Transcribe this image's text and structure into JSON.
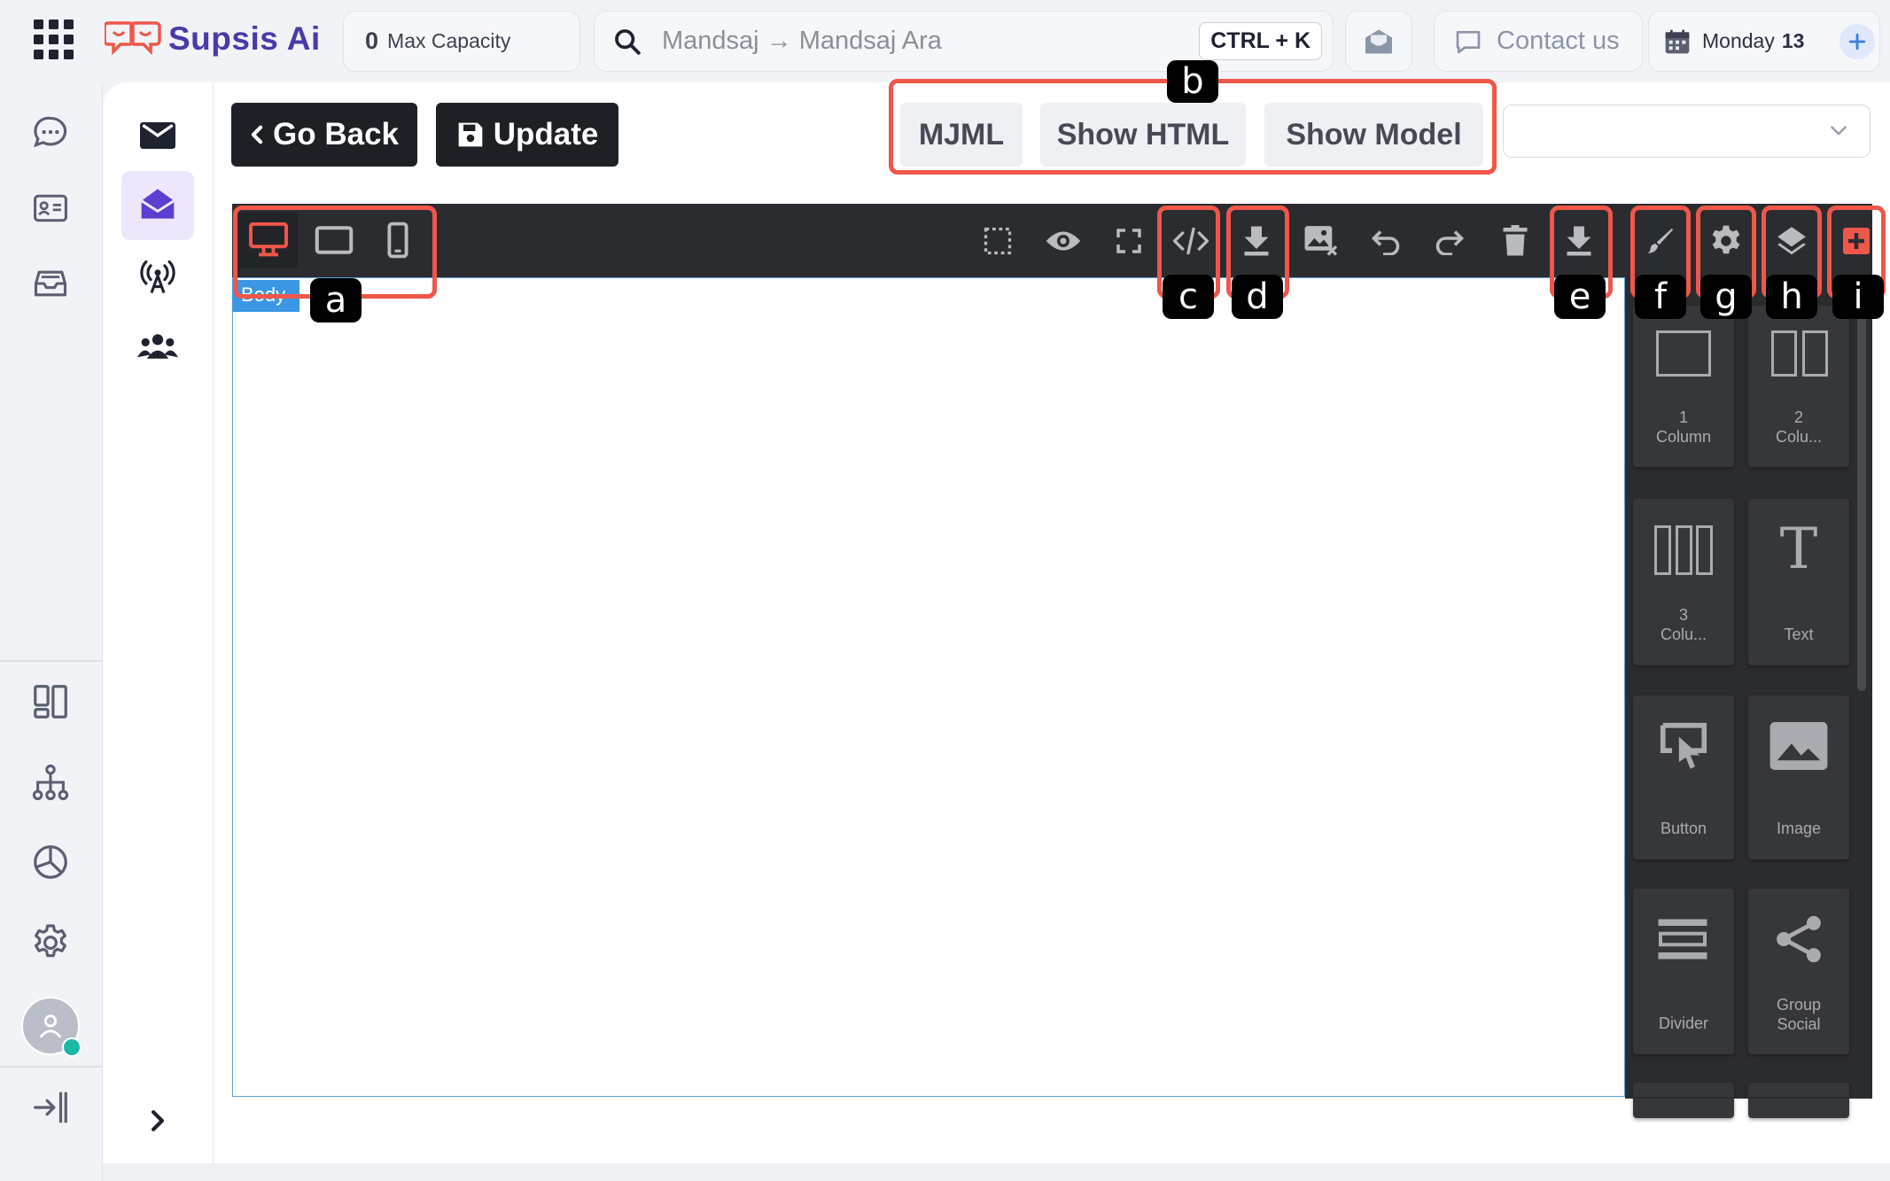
{
  "app": {
    "name": "Supsis Ai",
    "brand_color": "#4a3aa8",
    "logo_accent": "#f0564a"
  },
  "topbar": {
    "capacity_value": "0",
    "capacity_label": "Max Capacity",
    "search_placeholder": "Mandsaj → Mandsaj Ara",
    "search_shortcut": "CTRL + K",
    "contact_label": "Contact us",
    "date_label": "Monday",
    "date_day": "13"
  },
  "main": {
    "back_label": "Go Back",
    "update_label": "Update",
    "view_tabs": [
      {
        "label": "MJML"
      },
      {
        "label": "Show HTML"
      },
      {
        "label": "Show Model"
      }
    ],
    "select_value": ""
  },
  "editor": {
    "body_tag": "Body",
    "devices": [
      "desktop-icon",
      "tablet-icon",
      "mobile-icon"
    ],
    "active_device": "desktop",
    "toolbar_actions": [
      "select-outline-icon",
      "eye-icon",
      "fullscreen-icon",
      "code-icon",
      "download-icon",
      "image-remove-icon",
      "undo-icon",
      "redo-icon",
      "trash-icon"
    ],
    "panel_actions": [
      "download-icon",
      "brush-icon",
      "gear-icon",
      "layers-icon",
      "plus-icon"
    ],
    "active_color": "#f0564a",
    "blocks": [
      {
        "label_line1": "1",
        "label_line2": "Column",
        "icon": "one-column-icon"
      },
      {
        "label_line1": "2",
        "label_line2": "Colu...",
        "icon": "two-column-icon"
      },
      {
        "label_line1": "3",
        "label_line2": "Colu...",
        "icon": "three-column-icon"
      },
      {
        "label_line1": "",
        "label_line2": "Text",
        "icon": "text-icon"
      },
      {
        "label_line1": "",
        "label_line2": "Button",
        "icon": "button-icon"
      },
      {
        "label_line1": "",
        "label_line2": "Image",
        "icon": "image-icon"
      },
      {
        "label_line1": "",
        "label_line2": "Divider",
        "icon": "divider-icon"
      },
      {
        "label_line1": "Group",
        "label_line2": "Social",
        "icon": "share-icon"
      }
    ]
  },
  "annotations": {
    "a": "a",
    "b": "b",
    "c": "c",
    "d": "d",
    "e": "e",
    "f": "f",
    "g": "g",
    "h": "h",
    "i": "i",
    "color": "#f0564a"
  }
}
